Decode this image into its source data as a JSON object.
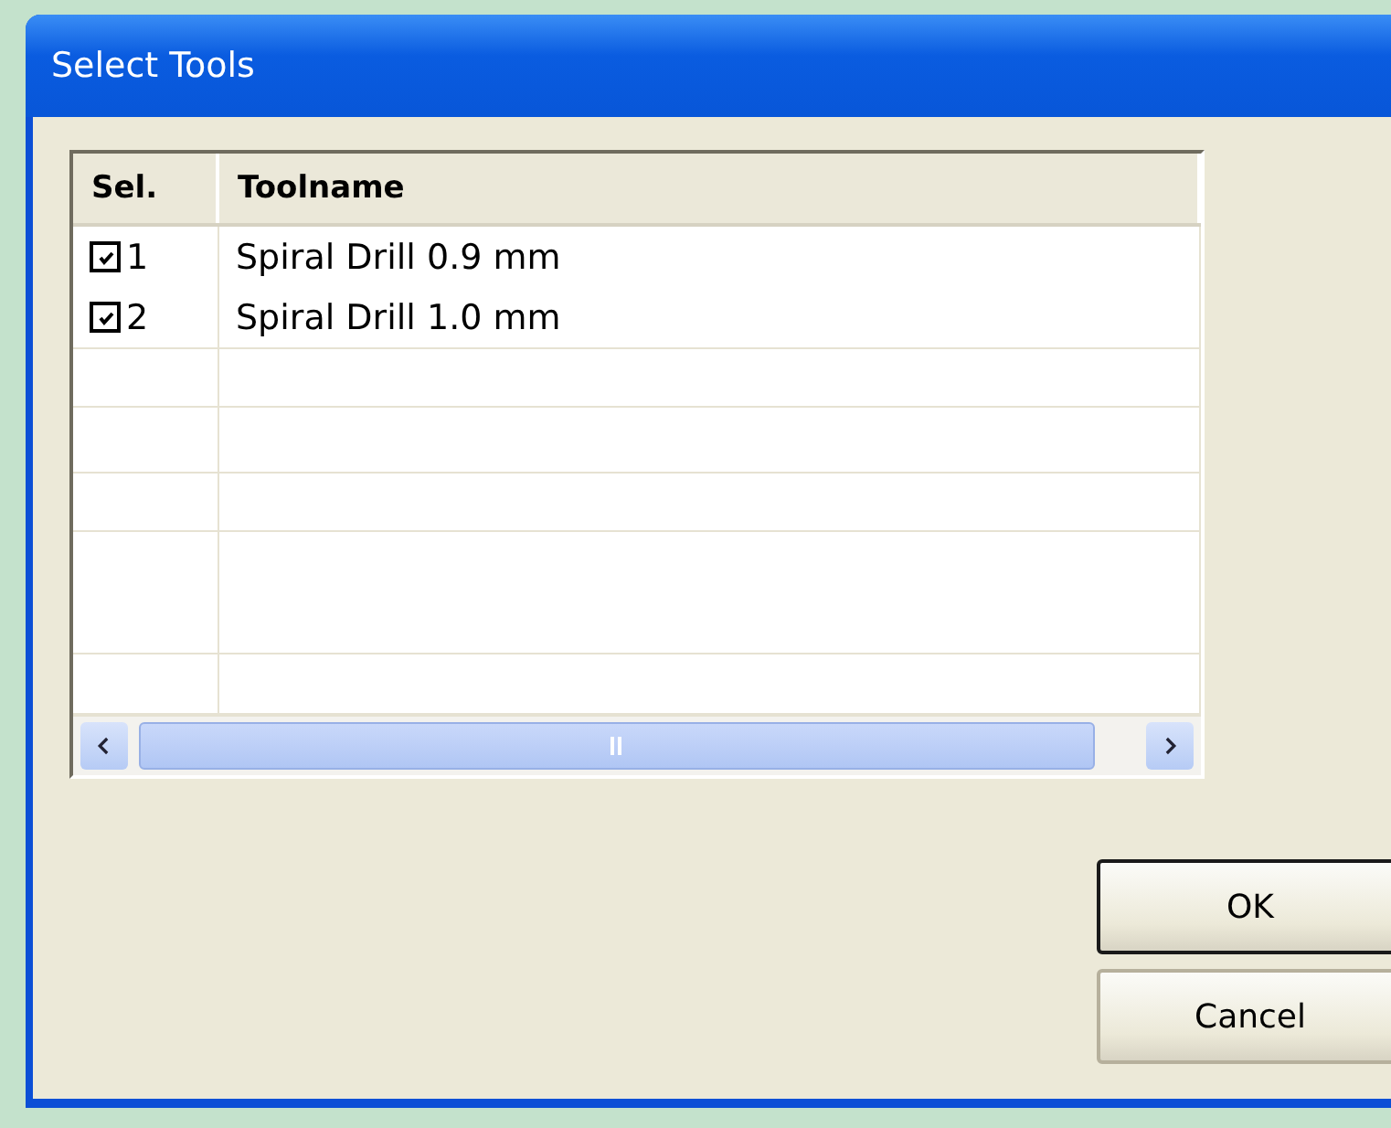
{
  "window": {
    "title": "Select Tools"
  },
  "table": {
    "columns": [
      "Sel.",
      "Toolname"
    ],
    "rows": [
      {
        "number": "1",
        "checked": true,
        "toolname": "Spiral Drill 0.9 mm"
      },
      {
        "number": "2",
        "checked": true,
        "toolname": "Spiral Drill 1.0 mm"
      }
    ]
  },
  "buttons": [
    {
      "label": "OK",
      "default": true
    },
    {
      "label": "Cancel",
      "default": false
    }
  ]
}
